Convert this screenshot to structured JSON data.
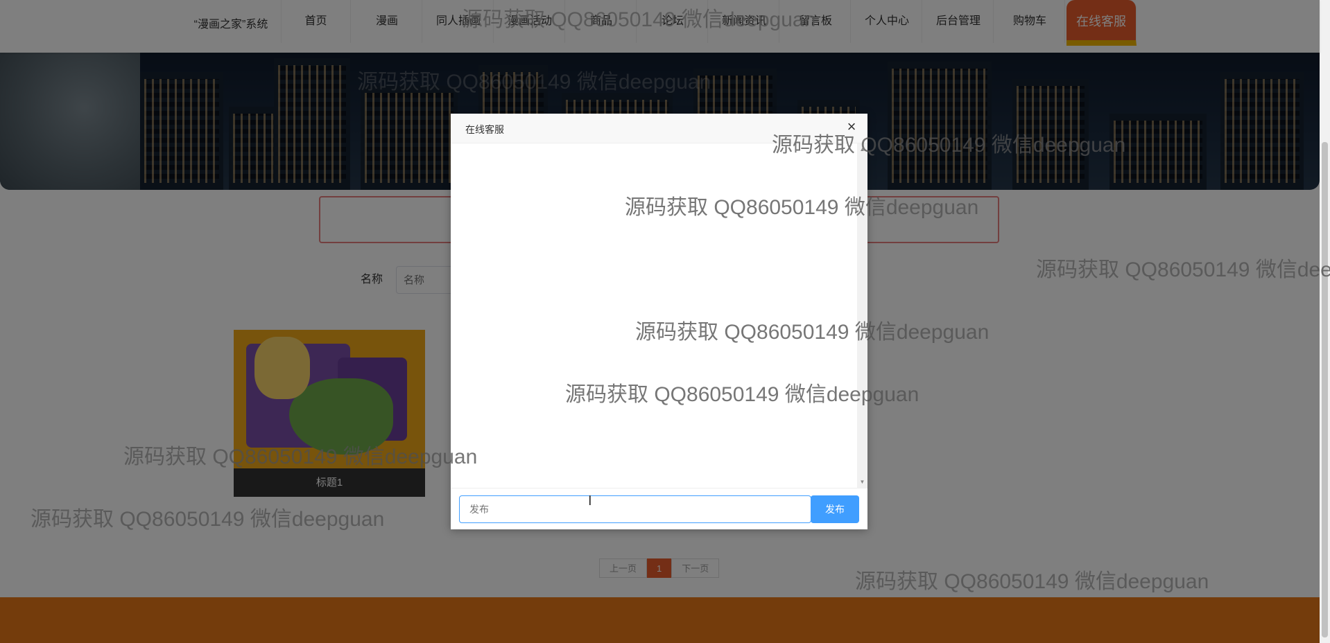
{
  "header": {
    "brand": "“漫画之家”系统",
    "nav": [
      {
        "label": "首页"
      },
      {
        "label": "漫画"
      },
      {
        "label": "同人插画"
      },
      {
        "label": "漫画活动"
      },
      {
        "label": "商品"
      },
      {
        "label": "论坛"
      },
      {
        "label": "新闻资讯"
      },
      {
        "label": "留言板"
      },
      {
        "label": "个人中心"
      },
      {
        "label": "后台管理"
      },
      {
        "label": "购物车"
      },
      {
        "label": "在线客服",
        "active": true
      }
    ]
  },
  "search": {
    "name_label": "名称",
    "name_placeholder": "名称"
  },
  "card": {
    "title": "标题1"
  },
  "pagination": {
    "prev": "上一页",
    "current": "1",
    "next": "下一页"
  },
  "dialog": {
    "title": "在线客服",
    "close_symbol": "×",
    "input_placeholder": "发布",
    "publish_label": "发布"
  },
  "watermark": {
    "text": "源码获取 QQ86050149 微信deepguan"
  },
  "colors": {
    "accent": "#e85d2c",
    "active_underline": "#f2b600",
    "footer": "#e87818",
    "primary_button": "#409eff"
  }
}
